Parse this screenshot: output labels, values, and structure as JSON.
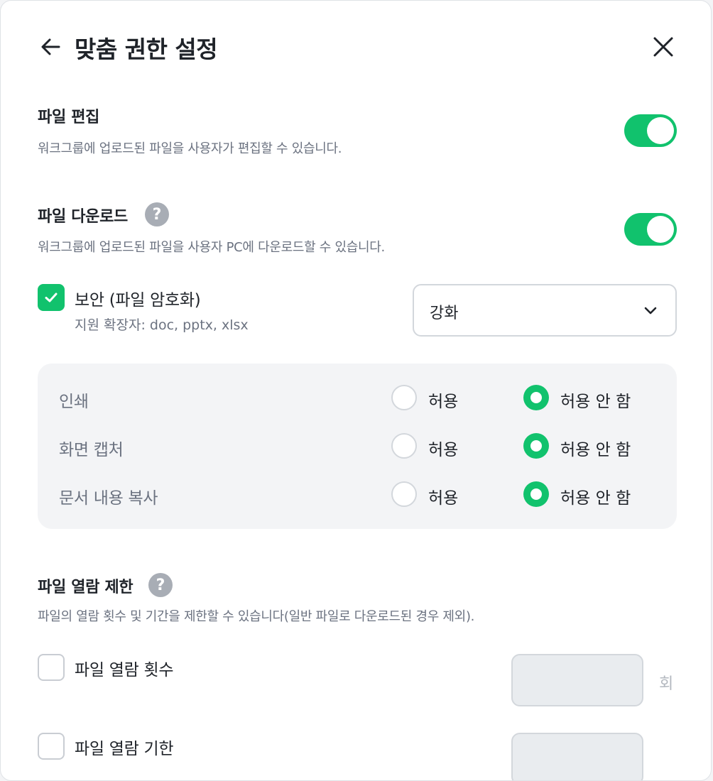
{
  "header": {
    "title": "맞춤 권한 설정",
    "back_icon": "arrow-left-icon",
    "close_icon": "close-icon"
  },
  "file_edit": {
    "title": "파일 편집",
    "description": "워크그룹에 업로드된 파일을 사용자가 편집할 수 있습니다.",
    "enabled": true
  },
  "file_download": {
    "title": "파일 다운로드",
    "help_icon": "?",
    "description": "워크그룹에 업로드된 파일을 사용자 PC에 다운로드할 수 있습니다.",
    "enabled": true,
    "security": {
      "label": "보안 (파일 암호화)",
      "sub": "지원 확장자: doc, pptx, xlsx",
      "checked": true,
      "level_selected": "강화"
    },
    "permissions": [
      {
        "label": "인쇄",
        "allow": "허용",
        "deny": "허용 안 함",
        "selected": "deny"
      },
      {
        "label": "화면 캡처",
        "allow": "허용",
        "deny": "허용 안 함",
        "selected": "deny"
      },
      {
        "label": "문서 내용 복사",
        "allow": "허용",
        "deny": "허용 안 함",
        "selected": "deny"
      }
    ]
  },
  "file_view_limit": {
    "title": "파일 열람 제한",
    "help_icon": "?",
    "description": "파일의 열람 횟수 및 기간을 제한할 수 있습니다(일반 파일로 다운로드된 경우 제외).",
    "count": {
      "label": "파일 열람 횟수",
      "unit": "회",
      "value": "",
      "checked": false
    },
    "period": {
      "label": "파일 열람 기한",
      "value": "",
      "checked": false
    }
  },
  "colors": {
    "accent": "#11c26d",
    "panel_bg": "#f3f4f6",
    "text_primary": "#1f2329",
    "text_secondary": "#6b7280"
  }
}
